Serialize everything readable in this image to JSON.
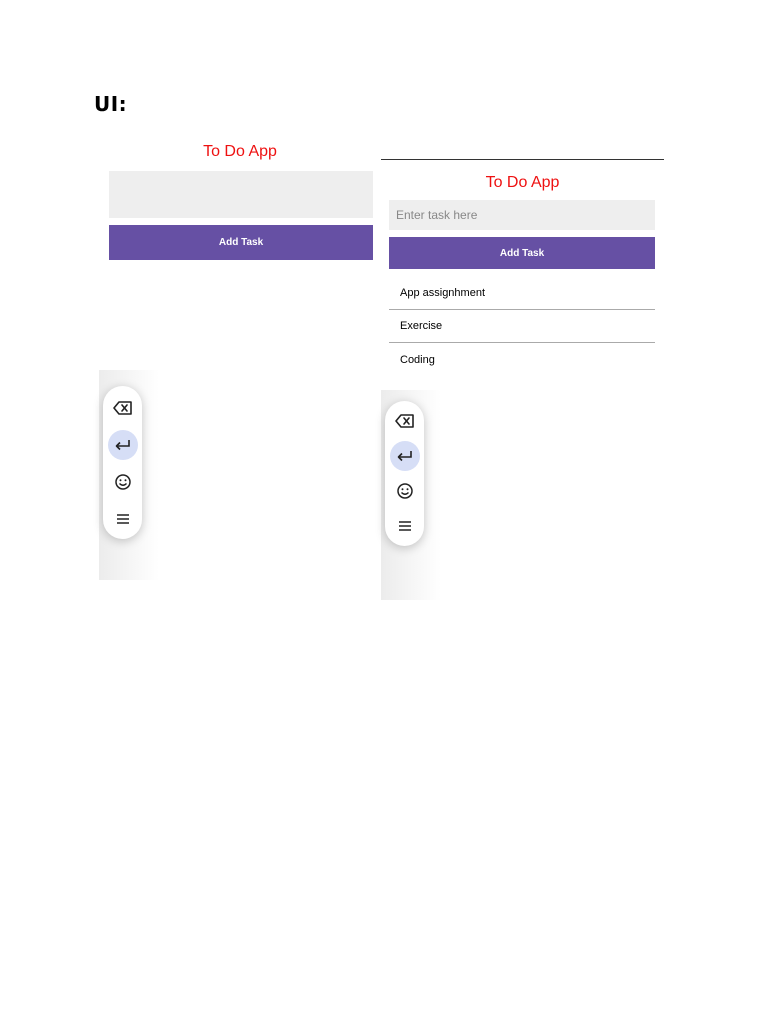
{
  "document": {
    "heading": "UI:"
  },
  "screens": {
    "left": {
      "title": "To Do App",
      "input": {
        "value": "",
        "placeholder": ""
      },
      "add_button": "Add Task",
      "tasks": []
    },
    "right": {
      "title": "To Do App",
      "input": {
        "value": "",
        "placeholder": "Enter task here"
      },
      "add_button": "Add Task",
      "tasks": [
        "App assignhment",
        "Exercise",
        "Coding"
      ]
    }
  },
  "keyboard_toolbar": {
    "keys": [
      "backspace-icon",
      "enter-icon",
      "emoji-icon",
      "menu-icon"
    ],
    "active_key": "enter-icon"
  },
  "colors": {
    "title": "#ee1111",
    "button": "#6650a4",
    "input_bg": "#eeeeee",
    "active_key_bg": "#d6def6"
  }
}
